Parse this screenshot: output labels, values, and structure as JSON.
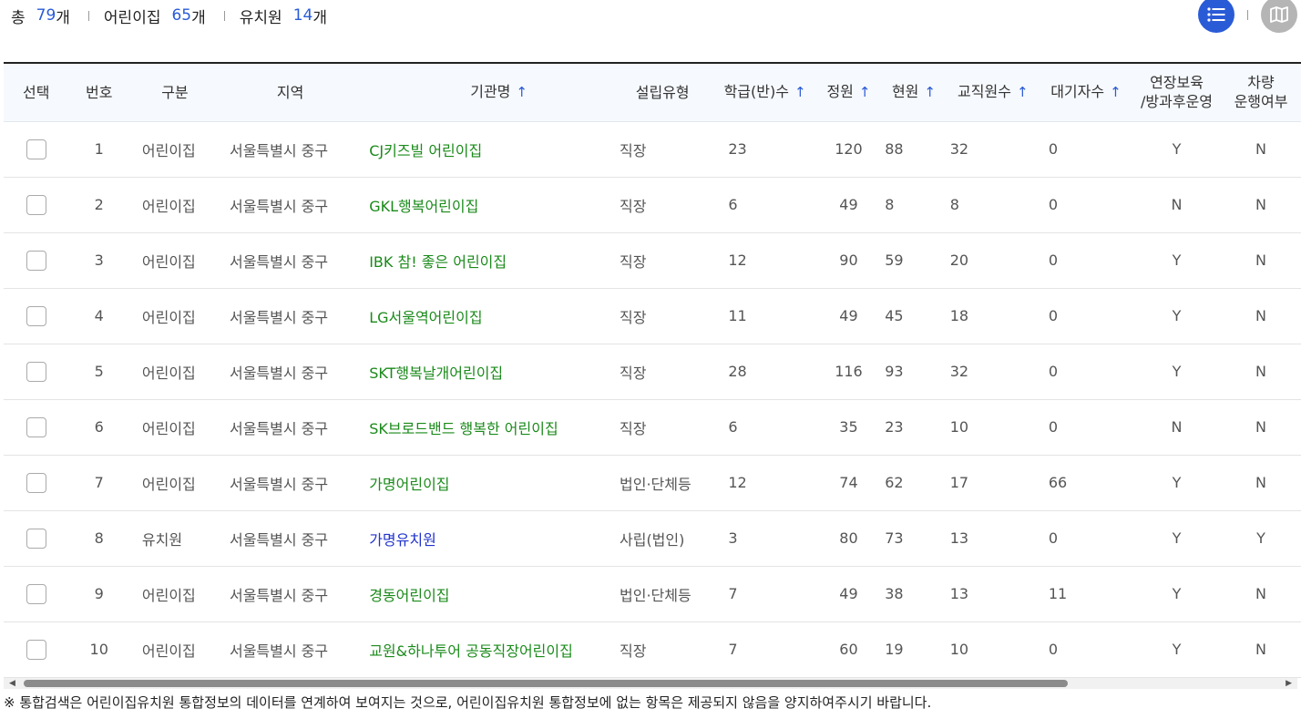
{
  "summary": {
    "total_label": "총",
    "total_count": "79",
    "total_unit": "개",
    "daycare_label": "어린이집",
    "daycare_count": "65",
    "daycare_unit": "개",
    "kinder_label": "유치원",
    "kinder_count": "14",
    "kinder_unit": "개"
  },
  "view": {
    "list_icon": "list-icon",
    "map_icon": "map-icon",
    "active": "list",
    "accent": "#2a5bd7"
  },
  "headers": {
    "select": "선택",
    "no": "번호",
    "type": "구분",
    "region": "지역",
    "name": "기관명",
    "found": "설립유형",
    "classes": "학급(반)수",
    "capacity": "정원",
    "current": "현원",
    "staff": "교직원수",
    "waiting": "대기자수",
    "extended_1": "연장보육",
    "extended_2": "/방과후운영",
    "vehicle_1": "차량",
    "vehicle_2": "운행여부",
    "sort_arrow": "↑"
  },
  "rows": [
    {
      "no": "1",
      "type": "어린이집",
      "region": "서울특별시 중구",
      "name": "CJ키즈빌 어린이집",
      "found": "직장",
      "classes": "23",
      "capacity": "120",
      "current": "88",
      "staff": "32",
      "waiting": "0",
      "extended": "Y",
      "vehicle": "N"
    },
    {
      "no": "2",
      "type": "어린이집",
      "region": "서울특별시 중구",
      "name": "GKL행복어린이집",
      "found": "직장",
      "classes": "6",
      "capacity": "49",
      "current": "8",
      "staff": "8",
      "waiting": "0",
      "extended": "N",
      "vehicle": "N"
    },
    {
      "no": "3",
      "type": "어린이집",
      "region": "서울특별시 중구",
      "name": "IBK 참! 좋은 어린이집",
      "found": "직장",
      "classes": "12",
      "capacity": "90",
      "current": "59",
      "staff": "20",
      "waiting": "0",
      "extended": "Y",
      "vehicle": "N"
    },
    {
      "no": "4",
      "type": "어린이집",
      "region": "서울특별시 중구",
      "name": "LG서울역어린이집",
      "found": "직장",
      "classes": "11",
      "capacity": "49",
      "current": "45",
      "staff": "18",
      "waiting": "0",
      "extended": "Y",
      "vehicle": "N"
    },
    {
      "no": "5",
      "type": "어린이집",
      "region": "서울특별시 중구",
      "name": "SKT행복날개어린이집",
      "found": "직장",
      "classes": "28",
      "capacity": "116",
      "current": "93",
      "staff": "32",
      "waiting": "0",
      "extended": "Y",
      "vehicle": "N"
    },
    {
      "no": "6",
      "type": "어린이집",
      "region": "서울특별시 중구",
      "name": "SK브로드밴드 행복한 어린이집",
      "found": "직장",
      "classes": "6",
      "capacity": "35",
      "current": "23",
      "staff": "10",
      "waiting": "0",
      "extended": "N",
      "vehicle": "N"
    },
    {
      "no": "7",
      "type": "어린이집",
      "region": "서울특별시 중구",
      "name": "가명어린이집",
      "found": "법인·단체등",
      "classes": "12",
      "capacity": "74",
      "current": "62",
      "staff": "17",
      "waiting": "66",
      "extended": "Y",
      "vehicle": "N"
    },
    {
      "no": "8",
      "type": "유치원",
      "region": "서울특별시 중구",
      "name": "가명유치원",
      "found": "사립(법인)",
      "classes": "3",
      "capacity": "80",
      "current": "73",
      "staff": "13",
      "waiting": "0",
      "extended": "Y",
      "vehicle": "Y"
    },
    {
      "no": "9",
      "type": "어린이집",
      "region": "서울특별시 중구",
      "name": "경동어린이집",
      "found": "법인·단체등",
      "classes": "7",
      "capacity": "49",
      "current": "38",
      "staff": "13",
      "waiting": "11",
      "extended": "Y",
      "vehicle": "N"
    },
    {
      "no": "10",
      "type": "어린이집",
      "region": "서울특별시 중구",
      "name": "교원&하나투어 공동직장어린이집",
      "found": "직장",
      "classes": "7",
      "capacity": "60",
      "current": "19",
      "staff": "10",
      "waiting": "0",
      "extended": "Y",
      "vehicle": "N"
    }
  ],
  "colors": {
    "daycare_name": "#1a8a1a",
    "kinder_name": "#2233cc"
  },
  "footnote": "※ 통합검색은 어린이집유치원 통합정보의 데이터를 연계하여 보여지는 것으로, 어린이집유치원 통합정보에 없는 항목은 제공되지 않음을 양지하여주시기 바랍니다."
}
